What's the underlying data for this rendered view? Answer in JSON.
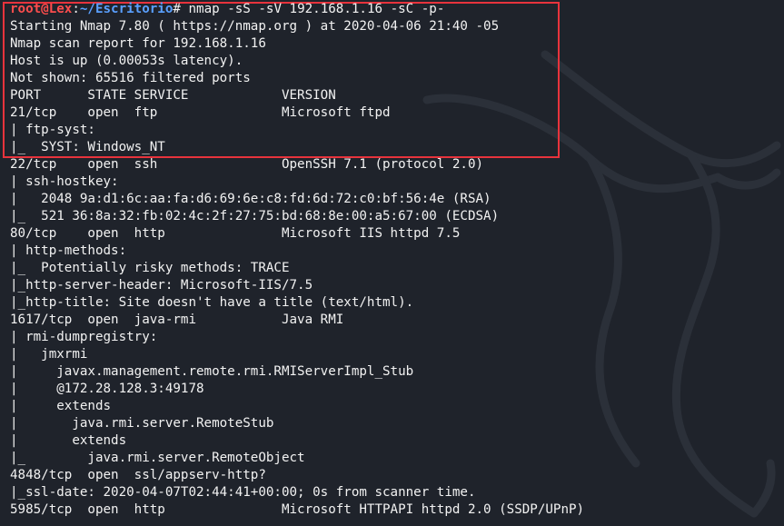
{
  "terminal": {
    "prompt": {
      "user": "root@Lex",
      "separator": ":",
      "path": "~/Escritorio",
      "symbol": "# ",
      "command": "nmap -sS -sV 192.168.1.16 -sC -p-"
    },
    "lines": [
      "Starting Nmap 7.80 ( https://nmap.org ) at 2020-04-06 21:40 -05",
      "Nmap scan report for 192.168.1.16",
      "Host is up (0.00053s latency).",
      "Not shown: 65516 filtered ports",
      "PORT      STATE SERVICE            VERSION",
      "21/tcp    open  ftp                Microsoft ftpd",
      "| ftp-syst:",
      "|_  SYST: Windows_NT",
      "22/tcp    open  ssh                OpenSSH 7.1 (protocol 2.0)",
      "| ssh-hostkey:",
      "|   2048 9a:d1:6c:aa:fa:d6:69:6e:c8:fd:6d:72:c0:bf:56:4e (RSA)",
      "|_  521 36:8a:32:fb:02:4c:2f:27:75:bd:68:8e:00:a5:67:00 (ECDSA)",
      "80/tcp    open  http               Microsoft IIS httpd 7.5",
      "| http-methods:",
      "|_  Potentially risky methods: TRACE",
      "|_http-server-header: Microsoft-IIS/7.5",
      "|_http-title: Site doesn't have a title (text/html).",
      "1617/tcp  open  java-rmi           Java RMI",
      "| rmi-dumpregistry:",
      "|   jmxrmi",
      "|     javax.management.remote.rmi.RMIServerImpl_Stub",
      "|     @172.28.128.3:49178",
      "|     extends",
      "|       java.rmi.server.RemoteStub",
      "|       extends",
      "|_        java.rmi.server.RemoteObject",
      "4848/tcp  open  ssl/appserv-http?",
      "|_ssl-date: 2020-04-07T02:44:41+00:00; 0s from scanner time.",
      "5985/tcp  open  http               Microsoft HTTPAPI httpd 2.0 (SSDP/UPnP)"
    ]
  },
  "colors": {
    "background": "#1f232b",
    "text": "#f2f2f2",
    "prompt_user": "#ff4d4d",
    "prompt_path": "#5aa0ff",
    "highlight_border": "#e8333c"
  }
}
